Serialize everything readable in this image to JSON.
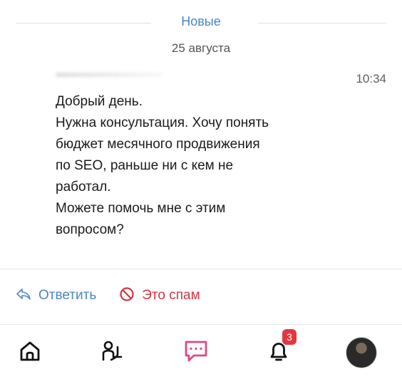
{
  "divider": {
    "label": "Новые"
  },
  "date": "25 августа",
  "message": {
    "time": "10:34",
    "lines": [
      "Добрый день.",
      "Нужна консультация. Хочу понять",
      "бюджет месячного продвижения",
      "по SEO, раньше ни с кем не",
      "работал.",
      "Можете помочь мне с этим",
      "вопросом?"
    ]
  },
  "actions": {
    "reply_label": "Ответить",
    "spam_label": "Это спам"
  },
  "tabbar": {
    "items": [
      {
        "id": "home",
        "icon": "home-icon"
      },
      {
        "id": "people",
        "icon": "people-icon"
      },
      {
        "id": "messages",
        "icon": "chat-icon"
      },
      {
        "id": "notifications",
        "icon": "bell-icon",
        "badge": "3"
      },
      {
        "id": "profile",
        "icon": "avatar"
      }
    ]
  },
  "colors": {
    "accent_blue": "#4a86c5",
    "spam_red": "#d6343d",
    "messages_pink": "#e0478a",
    "badge_red": "#e1383f"
  }
}
